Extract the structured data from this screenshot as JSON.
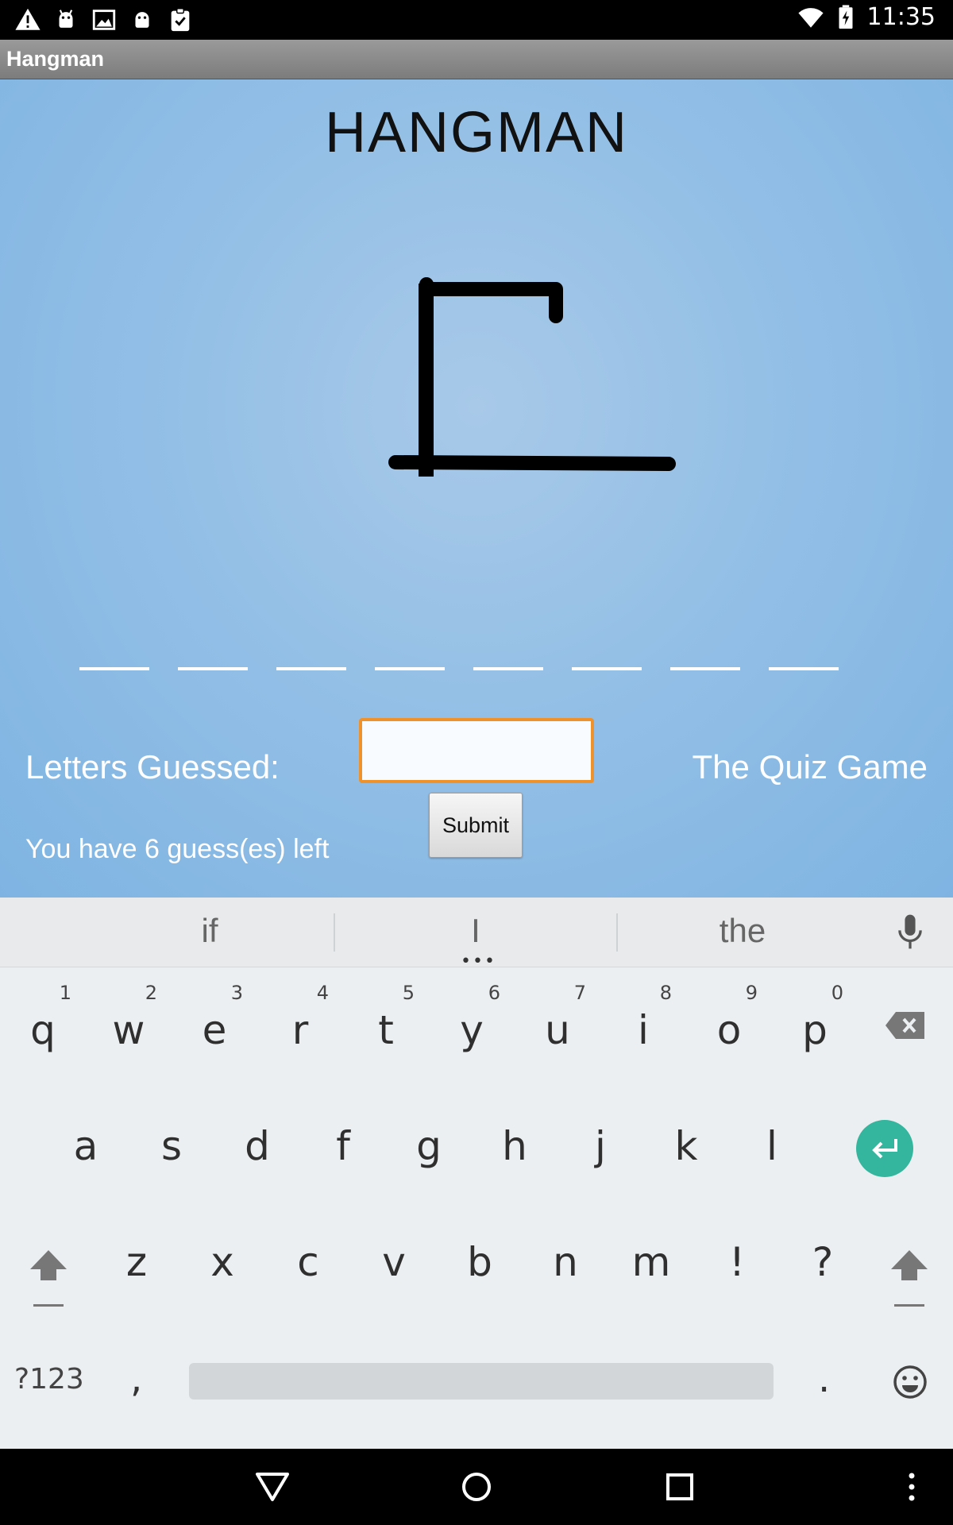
{
  "status_bar": {
    "time": "11:35",
    "left_icons": [
      "warning-icon",
      "android-icon",
      "image-icon",
      "android-icon",
      "clipboard-check-icon"
    ],
    "right_icons": [
      "wifi-icon",
      "battery-charging-icon"
    ]
  },
  "app": {
    "title": "Hangman"
  },
  "game": {
    "heading": "HANGMAN",
    "word_slot_count": 8,
    "letters_guessed_label": "Letters Guessed:",
    "guess_input_value": "",
    "quiz_link": "The Quiz Game",
    "submit_label": "Submit",
    "guesses_left_text": "You have 6 guess(es) left"
  },
  "keyboard": {
    "suggestions": [
      "if",
      "I",
      "the"
    ],
    "row1": [
      {
        "key": "q",
        "num": "1"
      },
      {
        "key": "w",
        "num": "2"
      },
      {
        "key": "e",
        "num": "3"
      },
      {
        "key": "r",
        "num": "4"
      },
      {
        "key": "t",
        "num": "5"
      },
      {
        "key": "y",
        "num": "6"
      },
      {
        "key": "u",
        "num": "7"
      },
      {
        "key": "i",
        "num": "8"
      },
      {
        "key": "o",
        "num": "9"
      },
      {
        "key": "p",
        "num": "0"
      }
    ],
    "row2": [
      "a",
      "s",
      "d",
      "f",
      "g",
      "h",
      "j",
      "k",
      "l"
    ],
    "row3": [
      "z",
      "x",
      "c",
      "v",
      "b",
      "n",
      "m",
      "!",
      "?"
    ],
    "symbols_label": "?123",
    "comma_label": ",",
    "period_label": ".",
    "accent_color": "#33b59e"
  },
  "nav_bar": {
    "icons": [
      "back-icon",
      "home-icon",
      "recents-icon",
      "more-icon"
    ]
  },
  "colors": {
    "input_border": "#f0922b",
    "game_background": "#93bfe6"
  }
}
